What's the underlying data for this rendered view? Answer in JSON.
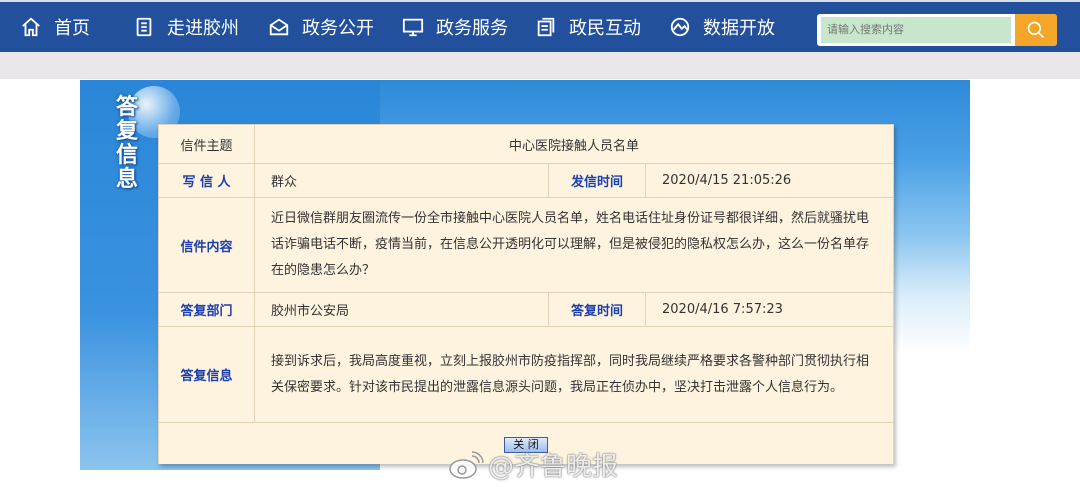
{
  "nav": {
    "items": [
      {
        "label": "首页",
        "icon": "home-icon"
      },
      {
        "label": "走进胶州",
        "icon": "document-icon"
      },
      {
        "label": "政务公开",
        "icon": "mail-icon"
      },
      {
        "label": "政务服务",
        "icon": "monitor-icon"
      },
      {
        "label": "政民互动",
        "icon": "files-icon"
      },
      {
        "label": "数据开放",
        "icon": "globe-icon"
      }
    ],
    "search_placeholder": "请输入搜索内容"
  },
  "side_title": "答复信息",
  "letter": {
    "subject_label": "信件主题",
    "subject": "中心医院接触人员名单",
    "writer_label": "写 信 人",
    "writer": "群众",
    "sent_label": "发信时间",
    "sent": "2020/4/15 21:05:26",
    "content_label": "信件内容",
    "content": "近日微信群朋友圈流传一份全市接触中心医院人员名单，姓名电话住址身份证号都很详细，然后就骚扰电话诈骗电话不断，疫情当前，在信息公开透明化可以理解，但是被侵犯的隐私权怎么办，这么一份名单存在的隐患怎么办？",
    "dept_label": "答复部门",
    "dept": "胶州市公安局",
    "reply_time_label": "答复时间",
    "reply_time": "2020/4/16 7:57:23",
    "reply_label": "答复信息",
    "reply": "接到诉求后，我局高度重视，立刻上报胶州市防疫指挥部，同时我局继续严格要求各警种部门贯彻执行相关保密要求。针对该市民提出的泄露信息源头问题，我局正在侦办中，坚决打击泄露个人信息行为。",
    "close_label": "关 闭"
  },
  "watermark": "@齐鲁晚报"
}
